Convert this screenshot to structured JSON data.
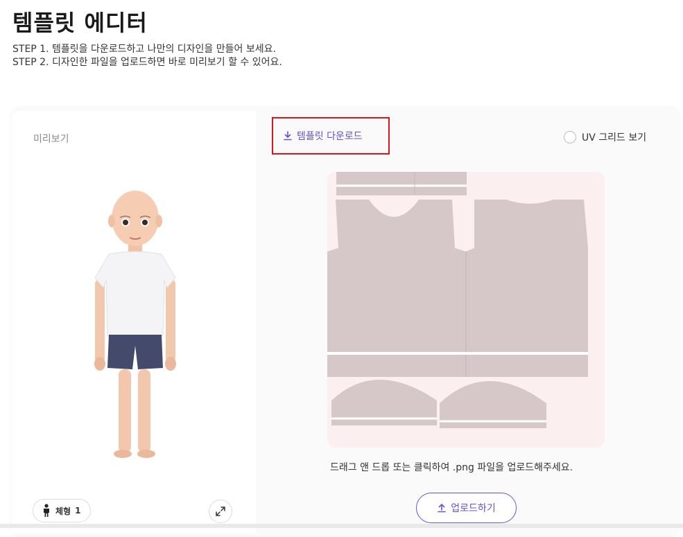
{
  "page": {
    "title": "템플릿 에디터",
    "step1": "STEP 1. 템플릿을 다운로드하고 나만의 디자인을 만들어 보세요.",
    "step2": "STEP 2. 디자인한 파일을 업로드하면 바로 미리보기 할 수 있어요."
  },
  "preview": {
    "label": "미리보기",
    "body_type_label": "체형",
    "body_type_value": "1"
  },
  "toolbar": {
    "download_label": "템플릿 다운로드",
    "uv_grid_label": "UV 그리드 보기",
    "uv_grid_checked": false
  },
  "upload": {
    "hint": "드래그 앤 드롭 또는 클릭하여 .png 파일을 업로드해주세요.",
    "button_label": "업로드하기"
  },
  "colors": {
    "accent": "#6a4fd8",
    "highlight_border": "#e0141c",
    "template_bg": "#fcefef",
    "shirt_fill": "#d6c8c8"
  }
}
